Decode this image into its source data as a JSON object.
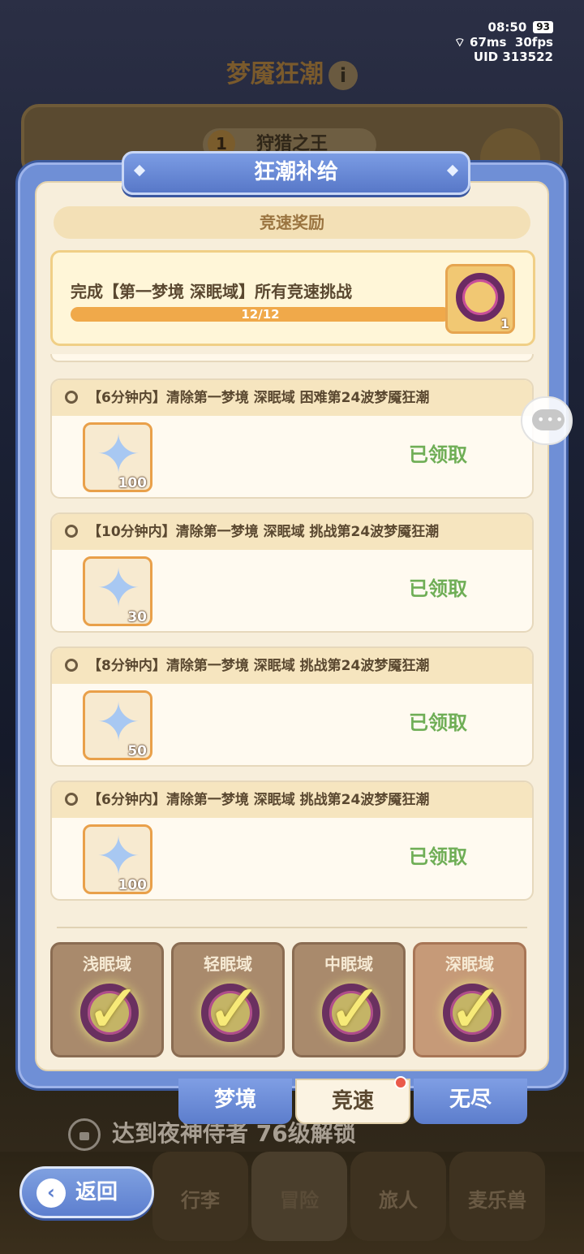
{
  "status_bar": {
    "time": "08:50",
    "battery": "93",
    "ping": "67ms",
    "fps": "30fps",
    "uid_label": "UID",
    "uid": "313522"
  },
  "background": {
    "title": "梦魇狂潮",
    "rank_num": "1",
    "rank_name": "狩猎之王",
    "unlock_text": "达到夜神侍者 76级解锁",
    "nav": [
      "行李",
      "冒险",
      "旅人",
      "麦乐兽"
    ],
    "back_label": "返回"
  },
  "modal": {
    "title": "狂潮补给",
    "section_title": "竞速奖励",
    "speed_card": {
      "text": "完成【第一梦境 深眠域】所有竞速挑战",
      "progress_label": "12/12",
      "progress_value": 12,
      "progress_max": 12,
      "reward_qty": "1"
    },
    "tasks": [
      {
        "title": "【6分钟内】清除第一梦境 深眠域 困难第24波梦魇狂潮",
        "reward_qty": "100",
        "status": "已领取"
      },
      {
        "title": "【10分钟内】清除第一梦境 深眠域 挑战第24波梦魇狂潮",
        "reward_qty": "30",
        "status": "已领取"
      },
      {
        "title": "【8分钟内】清除第一梦境 深眠域 挑战第24波梦魇狂潮",
        "reward_qty": "50",
        "status": "已领取"
      },
      {
        "title": "【6分钟内】清除第一梦境 深眠域 挑战第24波梦魇狂潮",
        "reward_qty": "100",
        "status": "已领取"
      }
    ],
    "tiers": [
      "浅眠域",
      "轻眠域",
      "中眠域",
      "深眠域"
    ],
    "tabs": [
      "梦境",
      "竞速",
      "无尽"
    ]
  },
  "colors": {
    "accent_blue": "#6f8fd6",
    "claimed_green": "#6fae56",
    "progress_orange": "#f0a94a"
  },
  "icons": {
    "reward": "crystal-star-icon",
    "frame": "dream-frame-icon",
    "check": "checkmark-icon"
  }
}
